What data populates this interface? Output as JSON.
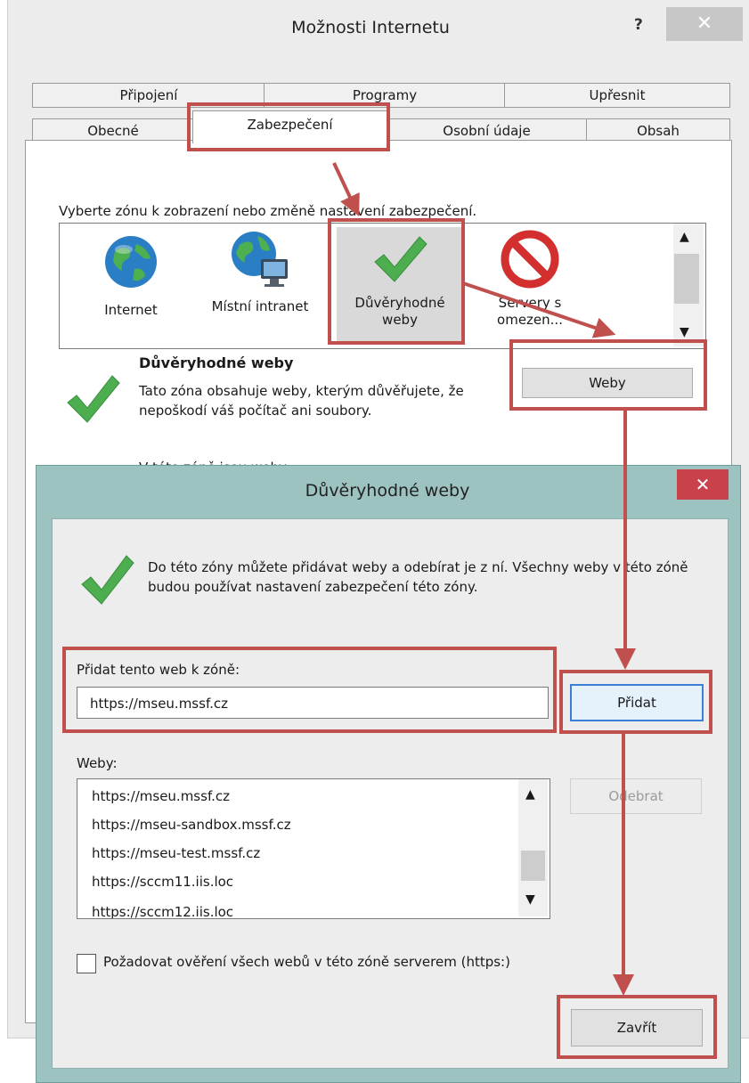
{
  "internet_options": {
    "title": "Možnosti Internetu",
    "help_glyph": "?",
    "close_glyph": "✕",
    "tabs_row1": [
      "Připojení",
      "Programy",
      "Upřesnit"
    ],
    "tabs_row2": [
      "Obecné",
      "Zabezpečení",
      "Osobní údaje",
      "Obsah"
    ],
    "active_tab": "Zabezpečení",
    "zone_prompt": "Vyberte zónu k zobrazení nebo změně nastavení zabezpečení.",
    "zones": [
      {
        "label": "Internet",
        "icon": "globe-icon"
      },
      {
        "label": "Místní intranet",
        "icon": "intranet-globe-icon"
      },
      {
        "label": "Důvěryhodné weby",
        "icon": "green-check-icon"
      },
      {
        "label": "Servery s omezen...",
        "icon": "restricted-icon"
      }
    ],
    "selected_zone": "Důvěryhodné weby",
    "zone_title": "Důvěryhodné weby",
    "zone_description": "Tato zóna obsahuje weby, kterým důvěřujete, že nepoškodí váš počítač ani soubory.",
    "zone_description_cut": "V této zóně jsou weby.",
    "sites_button": "Weby"
  },
  "trusted_sites_dialog": {
    "title": "Důvěryhodné weby",
    "close_glyph": "✕",
    "description": "Do této zóny můžete přidávat weby a odebírat je z ní. Všechny weby v této zóně budou používat nastavení zabezpečení této zóny.",
    "add_label": "Přidat tento web k zóně:",
    "add_value": "https://mseu.mssf.cz",
    "add_button": "Přidat",
    "sites_label": "Weby:",
    "sites": [
      "https://mseu.mssf.cz",
      "https://mseu-sandbox.mssf.cz",
      "https://mseu-test.mssf.cz",
      "https://sccm11.iis.loc",
      "https://sccm12.iis.loc"
    ],
    "remove_button": "Odebrat",
    "require_https_label": "Požadovat ověření všech webů v této zóně serverem (https:)",
    "require_https_checked": false,
    "close_button": "Zavřít"
  },
  "colors": {
    "highlight": "#c0504d",
    "dialog_frame": "#9cc3c0",
    "close_red": "#c8414b",
    "check_green": "#4cae4f"
  }
}
